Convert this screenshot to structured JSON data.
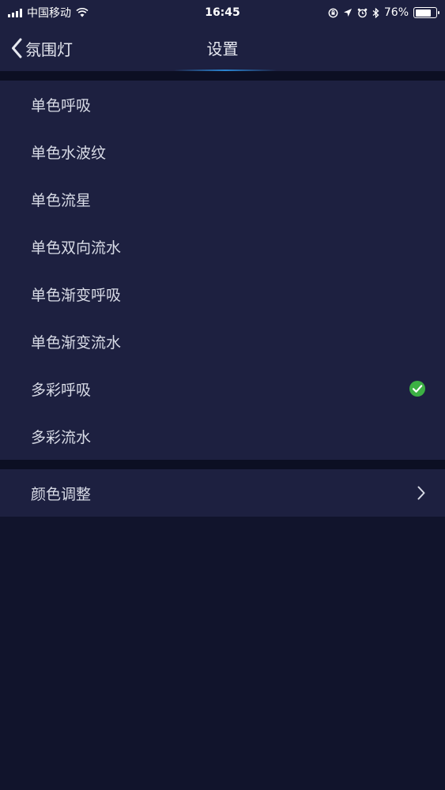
{
  "status_bar": {
    "carrier": "中国移动",
    "time": "16:45",
    "battery_text": "76%",
    "battery_level": 0.76,
    "icons": [
      "signal-icon",
      "wifi-icon",
      "lock-rotation-icon",
      "location-icon",
      "alarm-icon",
      "bluetooth-icon",
      "battery-icon"
    ]
  },
  "nav": {
    "back_label": "氛围灯",
    "title": "设置"
  },
  "modes": [
    {
      "label": "单色呼吸",
      "selected": false
    },
    {
      "label": "单色水波纹",
      "selected": false
    },
    {
      "label": "单色流星",
      "selected": false
    },
    {
      "label": "单色双向流水",
      "selected": false
    },
    {
      "label": "单色渐变呼吸",
      "selected": false
    },
    {
      "label": "单色渐变流水",
      "selected": false
    },
    {
      "label": "多彩呼吸",
      "selected": true
    },
    {
      "label": "多彩流水",
      "selected": false
    }
  ],
  "color_adjust": {
    "label": "颜色调整"
  },
  "colors": {
    "background": "#11142c",
    "panel": "#1d2040",
    "check": "#3cb043",
    "accent_glow": "#2b8fe0"
  }
}
